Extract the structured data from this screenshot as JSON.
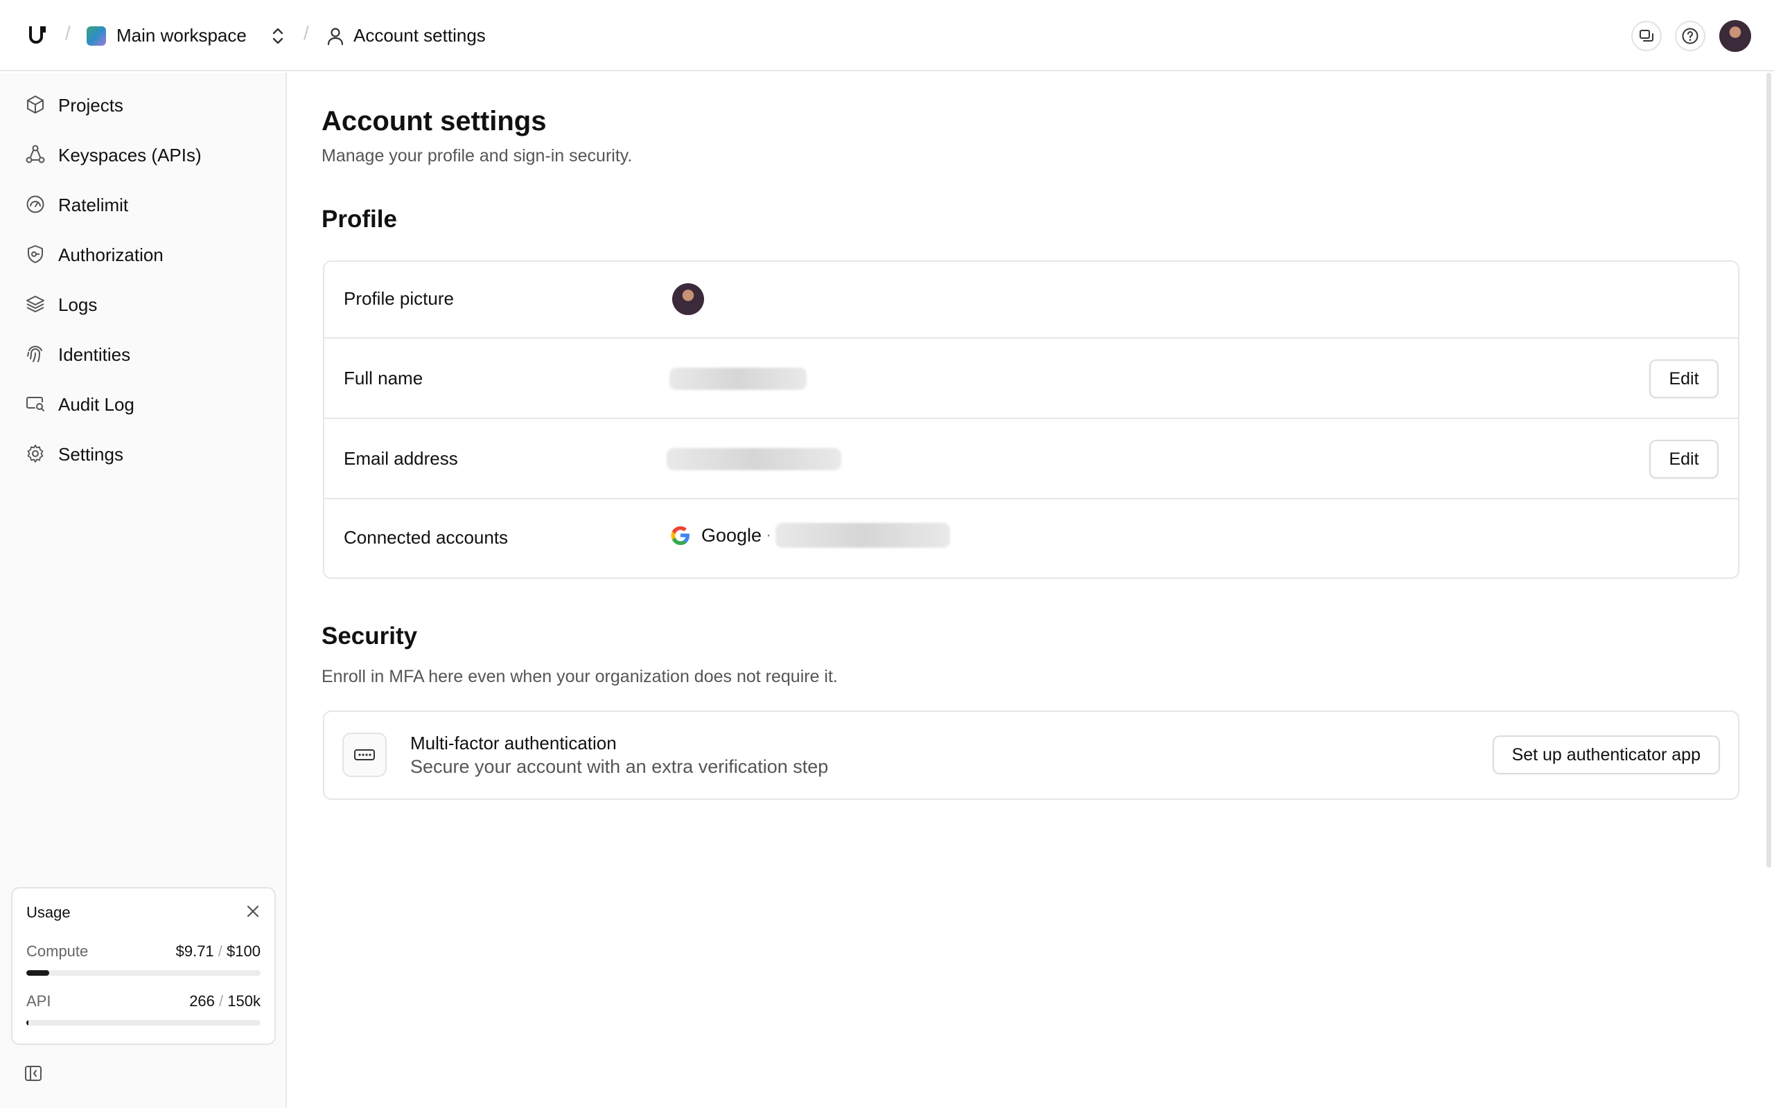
{
  "header": {
    "workspace_name": "Main workspace",
    "breadcrumb_separator": "/",
    "current_page": "Account settings"
  },
  "sidebar": {
    "items": [
      {
        "label": "Projects",
        "icon": "cube-icon"
      },
      {
        "label": "Keyspaces (APIs)",
        "icon": "nodes-icon"
      },
      {
        "label": "Ratelimit",
        "icon": "gauge-icon"
      },
      {
        "label": "Authorization",
        "icon": "shield-key-icon"
      },
      {
        "label": "Logs",
        "icon": "layers-icon"
      },
      {
        "label": "Identities",
        "icon": "fingerprint-icon"
      },
      {
        "label": "Audit Log",
        "icon": "monitor-search-icon"
      },
      {
        "label": "Settings",
        "icon": "gear-icon"
      }
    ],
    "usage": {
      "title": "Usage",
      "slash": "/",
      "compute": {
        "label": "Compute",
        "used": "$9.71",
        "limit": "$100",
        "fraction": 0.0971
      },
      "api": {
        "label": "API",
        "used": "266",
        "limit": "150k",
        "fraction": 0.0018
      }
    }
  },
  "main": {
    "title": "Account settings",
    "subtitle": "Manage your profile and sign-in security.",
    "profile": {
      "heading": "Profile",
      "picture_label": "Profile picture",
      "name_label": "Full name",
      "email_label": "Email address",
      "connected_label": "Connected accounts",
      "edit_label": "Edit",
      "provider": "Google",
      "dot": "·"
    },
    "security": {
      "heading": "Security",
      "subtitle": "Enroll in MFA here even when your organization does not require it.",
      "mfa_title": "Multi-factor authentication",
      "mfa_subtitle": "Secure your account with an extra verification step",
      "mfa_action": "Set up authenticator app"
    }
  },
  "colors": {
    "text": "#111111",
    "muted": "#555555",
    "border": "#e6e6e6",
    "sidebar_bg": "#fafafa",
    "progress": "#1a1a1a"
  }
}
